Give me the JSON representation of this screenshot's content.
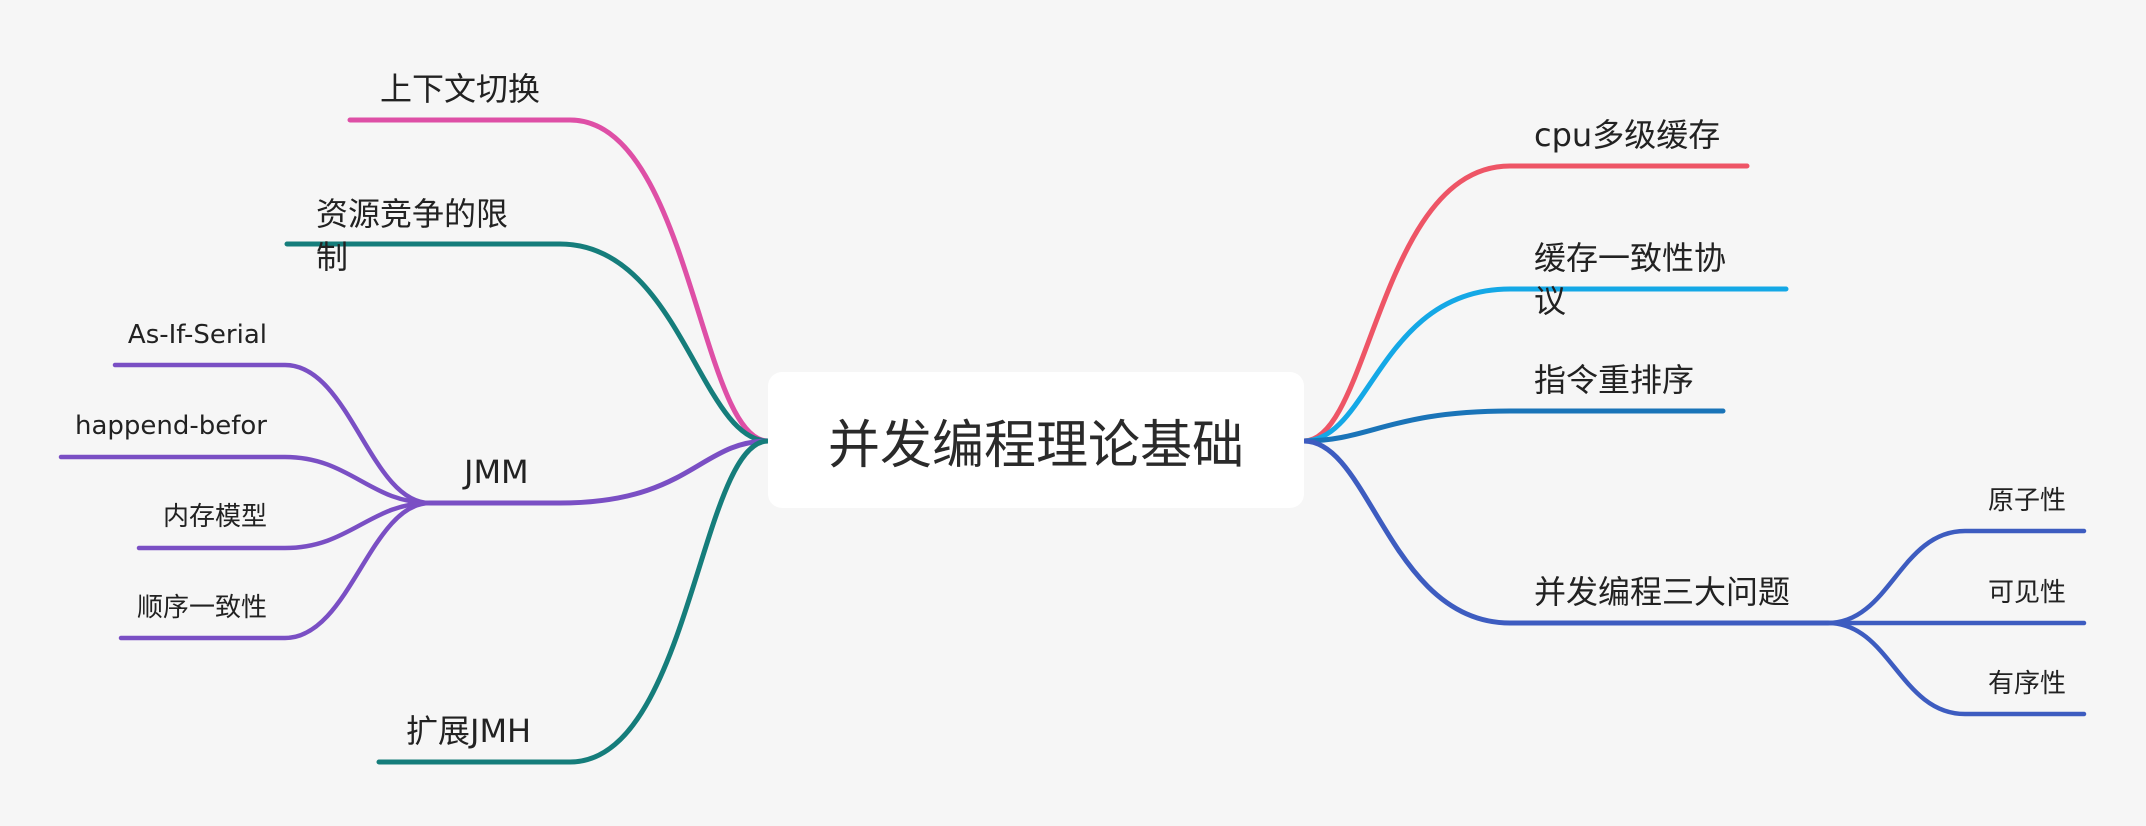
{
  "center": {
    "label": "并发编程理论基础"
  },
  "colors": {
    "background": "#f6f6f6",
    "context_switch": "#de4fa6",
    "teal": "#157d7b",
    "purple": "#7a4fc4",
    "red": "#ee5566",
    "cyan": "#14a8e6",
    "blue": "#1a74b8",
    "indigo": "#3d5cc0"
  },
  "left_branches": [
    {
      "label": "上下文切换"
    },
    {
      "label_line1": "资源竞争的限",
      "label_line2": "制"
    },
    {
      "label": "JMM",
      "children": [
        "As-If-Serial",
        "happend-befor",
        "内存模型",
        "顺序一致性"
      ]
    },
    {
      "label": "扩展JMH"
    }
  ],
  "right_branches": [
    {
      "label": "cpu多级缓存"
    },
    {
      "label_line1": "缓存一致性协",
      "label_line2": "议"
    },
    {
      "label": "指令重排序"
    },
    {
      "label": "并发编程三大问题",
      "children": [
        "原子性",
        "可见性",
        "有序性"
      ]
    }
  ]
}
